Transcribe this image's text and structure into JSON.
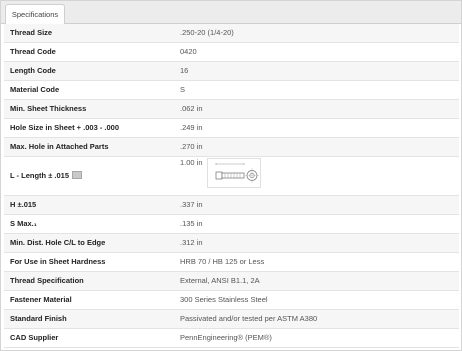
{
  "tabs": [
    {
      "label": "Specifications",
      "active": true
    }
  ],
  "rows": [
    {
      "label": "Thread Size",
      "value": ".250-20 (1/4-20)"
    },
    {
      "label": "Thread Code",
      "value": "0420"
    },
    {
      "label": "Length Code",
      "value": "16"
    },
    {
      "label": "Material Code",
      "value": "S"
    },
    {
      "label": "Min. Sheet Thickness",
      "value": ".062 in"
    },
    {
      "label": "Hole Size in Sheet + .003 - .000",
      "value": ".249 in"
    },
    {
      "label": "Max. Hole in Attached Parts",
      "value": ".270 in"
    },
    {
      "label": "L - Length ± .015",
      "value": "1.00 in",
      "icon": "info-icon",
      "thumbnail": "standoff-drawing-thumbnail"
    },
    {
      "label": "H ±.015",
      "value": ".337 in"
    },
    {
      "label": "S Max.₁",
      "value": ".135 in"
    },
    {
      "label": "Min. Dist. Hole C/L to Edge",
      "value": ".312 in"
    },
    {
      "label": "For Use in Sheet Hardness",
      "value": "HRB 70 / HB 125 or Less"
    },
    {
      "label": "Thread Specification",
      "value": "External, ANSI B1.1, 2A"
    },
    {
      "label": "Fastener Material",
      "value": "300 Series Stainless Steel"
    },
    {
      "label": "Standard Finish",
      "value": "Passivated and/or tested per ASTM A380"
    },
    {
      "label": "CAD Supplier",
      "value": "PennEngineering® (PEM®)"
    }
  ]
}
